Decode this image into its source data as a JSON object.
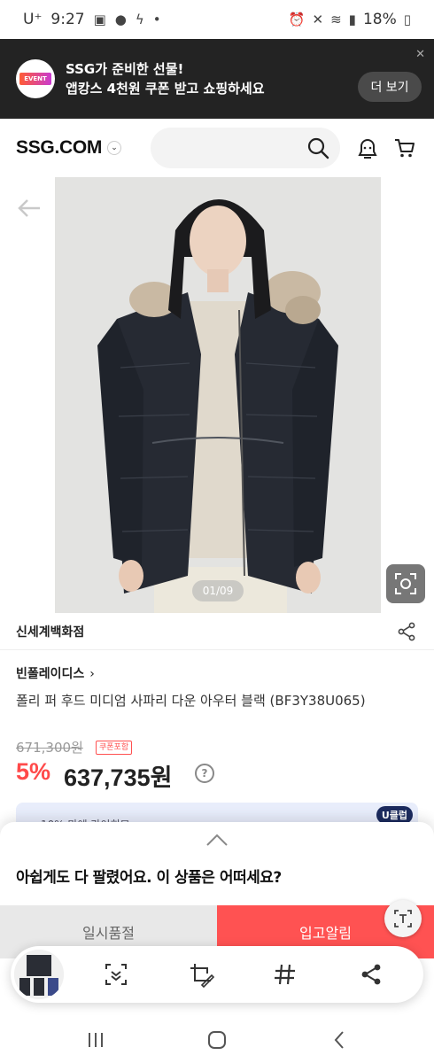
{
  "status_bar": {
    "carrier": "U⁺",
    "time": "9:27",
    "battery": "18%"
  },
  "promo_banner": {
    "badge_text": "EVENT",
    "line1": "SSG가 준비한 선물!",
    "line2": "앱캉스 4천원 쿠폰 받고 쇼핑하세요",
    "button_label": "더 보기",
    "close_glyph": "✕"
  },
  "header": {
    "logo": "SSG.COM",
    "logo_chevron": "⌄",
    "search_placeholder": ""
  },
  "gallery": {
    "counter": "01/09"
  },
  "product": {
    "store": "신세계백화점",
    "brand": "빈폴레이디스",
    "brand_chevron": "›",
    "name": "폴리 퍼 후드 미디엄 사파리 다운 아우터 블랙 (BF3Y38U065)",
    "original_price": "671,300원",
    "coupon_badge": "쿠폰포함",
    "discount": "5%",
    "sale_price": "637,735원",
    "help_glyph": "?"
  },
  "uclub": {
    "badge": "U클럽",
    "peek_text": "10% 마에 라이히므"
  },
  "sheet": {
    "message": "아쉽게도 다 팔렸어요. 이 상품은 어떠세요?",
    "soldout_label": "일시품절",
    "alert_label": "입고알림"
  },
  "colors": {
    "accent_red": "#ff5252",
    "promo_bg": "#232323",
    "uclub_navy": "#1c2b5e"
  }
}
